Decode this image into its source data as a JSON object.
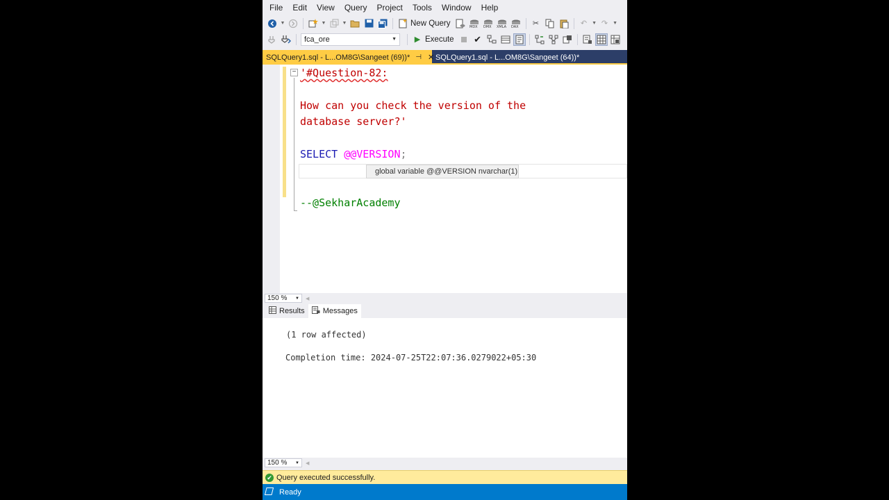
{
  "menu": [
    "File",
    "Edit",
    "View",
    "Query",
    "Project",
    "Tools",
    "Window",
    "Help"
  ],
  "toolbar": {
    "new_query_label": "New Query",
    "database": "fca_ore",
    "execute_label": "Execute"
  },
  "tabs": [
    {
      "label": "SQLQuery1.sql - L...OM8G\\Sangeet (69))*",
      "pin": "⊣",
      "close": "✕"
    },
    {
      "label": "SQLQuery1.sql - L...OM8G\\Sangeet (64))*"
    }
  ],
  "editor": {
    "fold_symbol": "−",
    "line1": "'#Question-82:",
    "line2": "How can you check the version of the",
    "line3": "database server?'",
    "select_kw": "SELECT",
    "select_var": "@@VERSION",
    "select_end": ";",
    "comment": "--@SekharAcademy",
    "tooltip": "global variable @@VERSION nvarchar(1)"
  },
  "zoom": {
    "editor": "150 %",
    "results": "150 %"
  },
  "results_tabs": [
    {
      "label": "Results",
      "icon": "grid-icon"
    },
    {
      "label": "Messages",
      "icon": "messages-icon"
    }
  ],
  "messages": {
    "line1": "(1 row affected)",
    "line2": "Completion time: 2024-07-25T22:07:36.0279022+05:30"
  },
  "query_status": "Query executed successfully.",
  "app_status": "Ready",
  "colors": {
    "tab_active": "#ffcc44",
    "tab_bar": "#2c3e68",
    "status_bar": "#007acc",
    "query_status_bg": "#ffeb9c"
  }
}
